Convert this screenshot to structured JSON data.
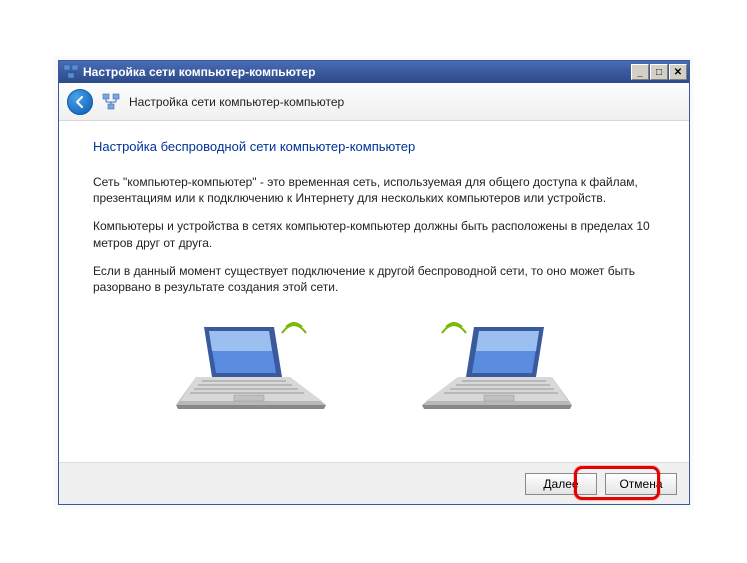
{
  "titlebar": {
    "text": "Настройка сети компьютер-компьютер"
  },
  "header": {
    "title": "Настройка сети компьютер-компьютер"
  },
  "content": {
    "heading": "Настройка беспроводной сети компьютер-компьютер",
    "para1": "Сеть \"компьютер-компьютер\" - это временная сеть, используемая для общего доступа к файлам, презентациям или к подключению к Интернету для нескольких компьютеров или устройств.",
    "para2": "Компьютеры и устройства в сетях компьютер-компьютер должны быть расположены в пределах 10 метров друг от друга.",
    "para3": "Если в данный момент существует подключение к другой беспроводной сети, то оно может быть разорвано в результате создания этой сети."
  },
  "footer": {
    "next": "Далее",
    "cancel": "Отмена"
  },
  "winbtns": {
    "min": "_",
    "max": "□",
    "close": "✕"
  }
}
